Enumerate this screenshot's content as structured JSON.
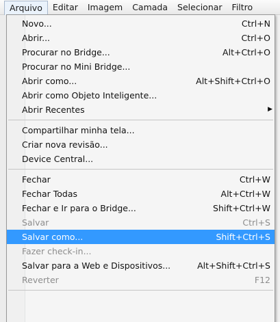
{
  "menubar": {
    "items": [
      {
        "label": "Arquivo",
        "active": true
      },
      {
        "label": "Editar"
      },
      {
        "label": "Imagem"
      },
      {
        "label": "Camada"
      },
      {
        "label": "Selecionar"
      },
      {
        "label": "Filtro"
      }
    ]
  },
  "file_menu": {
    "items": [
      {
        "label": "Novo...",
        "shortcut": "Ctrl+N"
      },
      {
        "label": "Abrir...",
        "shortcut": "Ctrl+O"
      },
      {
        "label": "Procurar no Bridge...",
        "shortcut": "Alt+Ctrl+O"
      },
      {
        "label": "Procurar no Mini Bridge...",
        "shortcut": ""
      },
      {
        "label": "Abrir como...",
        "shortcut": "Alt+Shift+Ctrl+O"
      },
      {
        "label": "Abrir como Objeto Inteligente...",
        "shortcut": ""
      },
      {
        "label": "Abrir Recentes",
        "shortcut": "",
        "submenu": true
      },
      {
        "separator": true
      },
      {
        "label": "Compartilhar minha tela...",
        "shortcut": ""
      },
      {
        "label": "Criar nova revisão...",
        "shortcut": ""
      },
      {
        "label": "Device Central...",
        "shortcut": ""
      },
      {
        "separator": true
      },
      {
        "label": "Fechar",
        "shortcut": "Ctrl+W"
      },
      {
        "label": "Fechar Todas",
        "shortcut": "Alt+Ctrl+W"
      },
      {
        "label": "Fechar e Ir para o Bridge...",
        "shortcut": "Shift+Ctrl+W"
      },
      {
        "label": "Salvar",
        "shortcut": "Ctrl+S",
        "disabled": true
      },
      {
        "label": "Salvar como...",
        "shortcut": "Shift+Ctrl+S",
        "selected": true
      },
      {
        "label": "Fazer check-in...",
        "shortcut": "",
        "disabled": true
      },
      {
        "label": "Salvar para a Web e Dispositivos...",
        "shortcut": "Alt+Shift+Ctrl+S"
      },
      {
        "label": "Reverter",
        "shortcut": "F12",
        "disabled": true
      }
    ]
  },
  "colors": {
    "selection": "#3399ff",
    "disabled_text": "#8d8d8d",
    "menu_background": "#f5f5f5"
  },
  "icons": {
    "submenu": "submenu-arrow-icon"
  }
}
